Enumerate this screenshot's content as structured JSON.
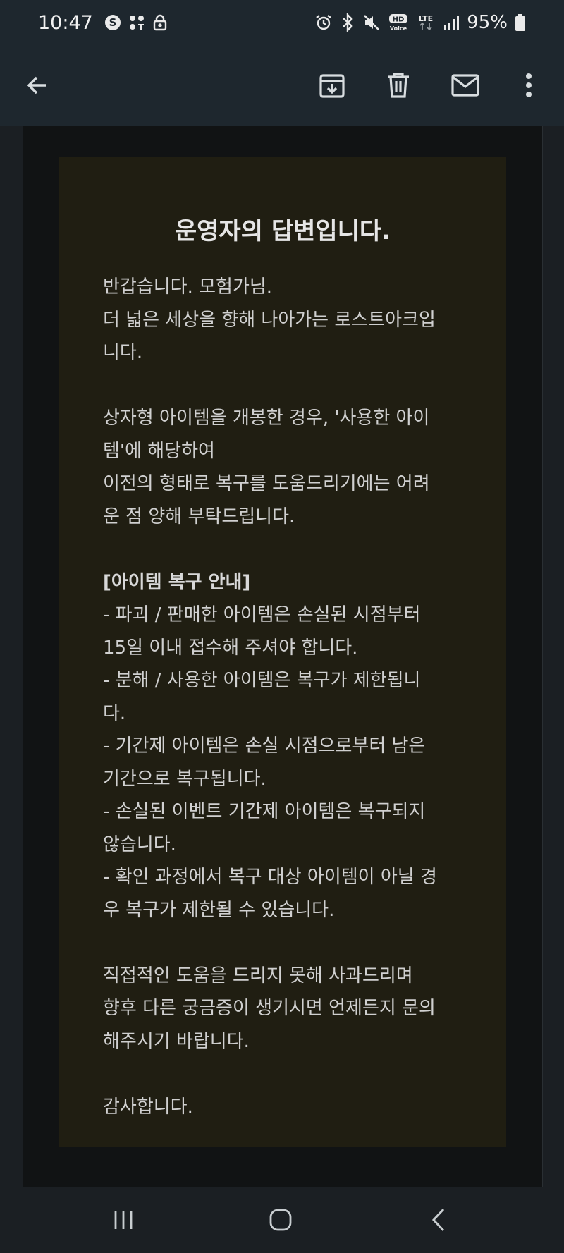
{
  "status_bar": {
    "time": "10:47",
    "battery": "95%",
    "hd_badge": "HD\nVoice",
    "network": "LTE"
  },
  "toolbar": {
    "icons": [
      "back-arrow-icon",
      "archive-icon",
      "delete-icon",
      "mark-unread-icon",
      "more-vert-icon"
    ]
  },
  "email": {
    "title": "운영자의 답변입니다.",
    "lines": [
      {
        "text": "반갑습니다. 모험가님.",
        "bold": false
      },
      {
        "text": "더 넓은 세상을 향해 나아가는 로스트아크입",
        "bold": false
      },
      {
        "text": "니다.",
        "bold": false
      },
      {
        "text": "",
        "bold": false
      },
      {
        "text": "상자형 아이템을 개봉한 경우, '사용한 아이",
        "bold": false
      },
      {
        "text": "템'에 해당하여",
        "bold": false
      },
      {
        "text": "이전의 형태로 복구를 도움드리기에는 어려",
        "bold": false
      },
      {
        "text": "운 점 양해 부탁드립니다.",
        "bold": false
      },
      {
        "text": "",
        "bold": false
      },
      {
        "text": "[아이템 복구 안내]",
        "bold": true
      },
      {
        "text": "- 파괴 / 판매한 아이템은 손실된 시점부터",
        "bold": false
      },
      {
        "text": "15일 이내 접수해 주셔야 합니다.",
        "bold": false
      },
      {
        "text": "- 분해 / 사용한 아이템은 복구가 제한됩니",
        "bold": false
      },
      {
        "text": "다.",
        "bold": false
      },
      {
        "text": "- 기간제 아이템은 손실 시점으로부터 남은",
        "bold": false
      },
      {
        "text": "기간으로 복구됩니다.",
        "bold": false
      },
      {
        "text": "- 손실된 이벤트 기간제 아이템은 복구되지",
        "bold": false
      },
      {
        "text": "않습니다.",
        "bold": false
      },
      {
        "text": "- 확인 과정에서 복구 대상 아이템이 아닐 경",
        "bold": false
      },
      {
        "text": "우 복구가 제한될 수 있습니다.",
        "bold": false
      },
      {
        "text": "",
        "bold": false
      },
      {
        "text": "직접적인 도움을 드리지 못해 사과드리며",
        "bold": false
      },
      {
        "text": "향후 다른 궁금증이 생기시면 언제든지 문의",
        "bold": false
      },
      {
        "text": "해주시기 바랍니다.",
        "bold": false
      },
      {
        "text": "",
        "bold": false
      },
      {
        "text": "감사합니다.",
        "bold": false
      }
    ]
  },
  "colors": {
    "status_bar_bg": "#1e272e",
    "page_bg": "#1b1f23",
    "mail_frame_bg": "#111314",
    "card_bg": "#201e12",
    "text": "#d0d0d0"
  }
}
